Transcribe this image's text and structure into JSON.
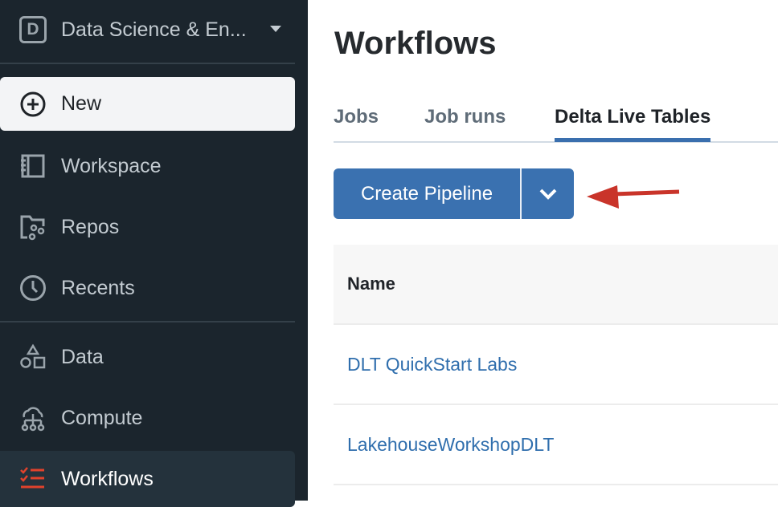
{
  "sidebar": {
    "workspace": {
      "initial": "D",
      "name": "Data Science & En..."
    },
    "items": [
      {
        "label": "New",
        "icon": "plus-circle-icon"
      },
      {
        "label": "Workspace",
        "icon": "notebook-icon"
      },
      {
        "label": "Repos",
        "icon": "repo-folder-icon"
      },
      {
        "label": "Recents",
        "icon": "clock-icon"
      },
      {
        "label": "Data",
        "icon": "shapes-icon"
      },
      {
        "label": "Compute",
        "icon": "cloud-network-icon"
      },
      {
        "label": "Workflows",
        "icon": "checklist-icon"
      }
    ]
  },
  "main": {
    "title": "Workflows",
    "tabs": [
      {
        "label": "Jobs"
      },
      {
        "label": "Job runs"
      },
      {
        "label": "Delta Live Tables",
        "active": true
      }
    ],
    "create_button": "Create Pipeline",
    "table": {
      "header": "Name",
      "rows": [
        {
          "name": "DLT QuickStart Labs"
        },
        {
          "name": "LakehouseWorkshopDLT"
        }
      ]
    }
  },
  "colors": {
    "sidebar": "#1b252d",
    "accent": "#3a71b0",
    "arrow": "#c9342a",
    "workflows_icon": "#e0422c"
  }
}
